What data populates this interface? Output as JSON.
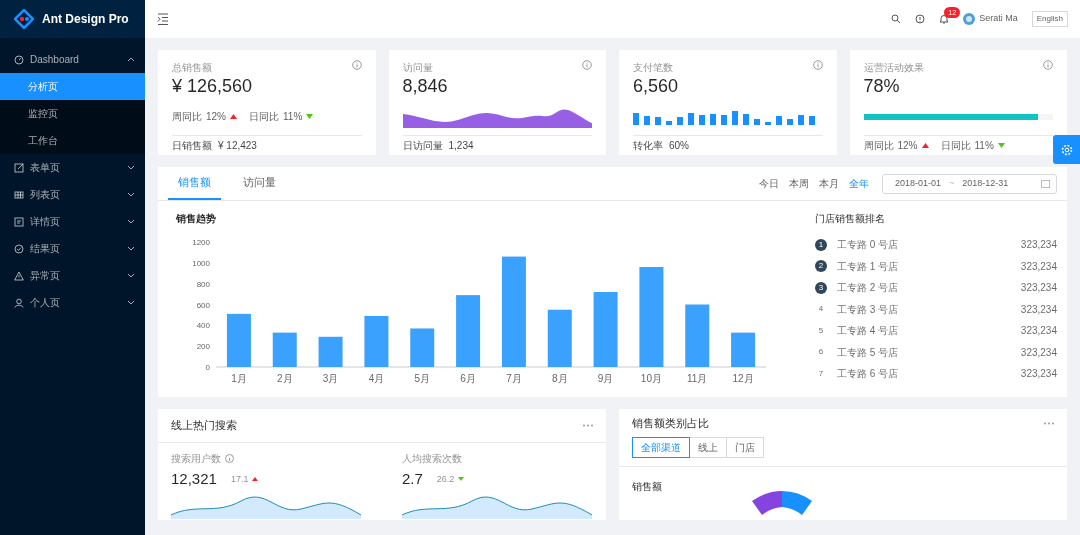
{
  "brand": "Ant Design Pro",
  "sidebar": {
    "items": [
      {
        "label": "Dashboard",
        "expanded": true,
        "children": [
          {
            "label": "分析页",
            "selected": true
          },
          {
            "label": "监控页",
            "selected": false
          },
          {
            "label": "工作台",
            "selected": false
          }
        ]
      },
      {
        "label": "表单页",
        "expanded": false
      },
      {
        "label": "列表页",
        "expanded": false
      },
      {
        "label": "详情页",
        "expanded": false
      },
      {
        "label": "结果页",
        "expanded": false
      },
      {
        "label": "异常页",
        "expanded": false
      },
      {
        "label": "个人页",
        "expanded": false
      }
    ]
  },
  "header": {
    "notifications": "12",
    "user": "Serati Ma",
    "language": "English"
  },
  "stats": [
    {
      "kind": "trend",
      "title": "总销售额",
      "value": "¥ 126,560",
      "changes": [
        {
          "label": "周同比",
          "value": "12%",
          "kind": "up"
        },
        {
          "label": "日同比",
          "value": "11%",
          "kind": "down"
        }
      ],
      "footer_label": "日销售额",
      "footer_value": "¥ 12,423"
    },
    {
      "kind": "area",
      "title": "访问量",
      "value": "8,846",
      "footer_label": "日访问量",
      "footer_value": "1,234"
    },
    {
      "kind": "bars",
      "title": "支付笔数",
      "value": "6,560",
      "footer_label": "转化率",
      "footer_value": "60%"
    },
    {
      "kind": "progress",
      "title": "运营活动效果",
      "value": "78%",
      "level": 0.92,
      "changes": [
        {
          "label": "周同比",
          "value": "12%",
          "kind": "up"
        },
        {
          "label": "日同比",
          "value": "11%",
          "kind": "down"
        }
      ]
    }
  ],
  "sales": {
    "tabs": [
      {
        "label": "销售额",
        "selected": true
      },
      {
        "label": "访问量",
        "selected": false
      }
    ],
    "ranges": [
      {
        "label": "今日",
        "selected": false
      },
      {
        "label": "本周",
        "selected": false
      },
      {
        "label": "本月",
        "selected": false
      },
      {
        "label": "全年",
        "selected": true
      }
    ],
    "date_start": "2018-01-01",
    "date_separator": "~",
    "date_end": "2018-12-31",
    "chart_title": "销售趋势",
    "chart_data": {
      "type": "bar",
      "categories": [
        "1月",
        "2月",
        "3月",
        "4月",
        "5月",
        "6月",
        "7月",
        "8月",
        "9月",
        "10月",
        "11月",
        "12月"
      ],
      "values": [
        510,
        330,
        290,
        490,
        370,
        690,
        1060,
        550,
        720,
        960,
        600,
        330
      ],
      "ylim": [
        0,
        1200
      ],
      "yticks": [
        0,
        200,
        400,
        600,
        800,
        1000,
        1200
      ]
    },
    "ranking_title": "门店销售额排名",
    "ranking": [
      {
        "rank": "1",
        "name": "工专路 0 号店",
        "value": "323,234",
        "highlighted": true
      },
      {
        "rank": "2",
        "name": "工专路 1 号店",
        "value": "323,234",
        "highlighted": true
      },
      {
        "rank": "3",
        "name": "工专路 2 号店",
        "value": "323,234",
        "highlighted": true
      },
      {
        "rank": "4",
        "name": "工专路 3 号店",
        "value": "323,234",
        "highlighted": false
      },
      {
        "rank": "5",
        "name": "工专路 4 号店",
        "value": "323,234",
        "highlighted": false
      },
      {
        "rank": "6",
        "name": "工专路 5 号店",
        "value": "323,234",
        "highlighted": false
      },
      {
        "rank": "7",
        "name": "工专路 6 号店",
        "value": "323,234",
        "highlighted": false
      }
    ]
  },
  "search": {
    "title": "线上热门搜索",
    "metrics": [
      {
        "label": "搜索用户数",
        "info": true,
        "value": "12,321",
        "change": "17.1",
        "kind": "up"
      },
      {
        "label": "人均搜索次数",
        "info": false,
        "value": "2.7",
        "change": "26.2",
        "kind": "down"
      }
    ]
  },
  "category": {
    "title": "销售额类别占比",
    "segments": [
      {
        "label": "全部渠道",
        "selected": true
      },
      {
        "label": "线上",
        "selected": false
      },
      {
        "label": "门店",
        "selected": false
      }
    ],
    "section_label": "销售额"
  }
}
